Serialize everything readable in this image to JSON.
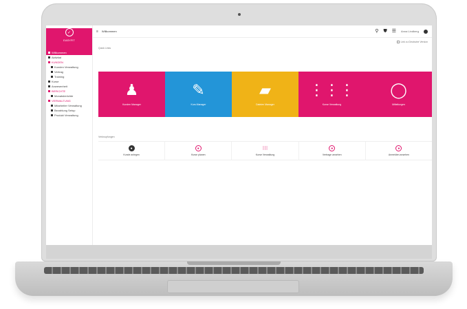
{
  "brand": {
    "name": "EASYFIT",
    "logo_icon": "logo-mark-icon"
  },
  "topbar": {
    "menu_icon": "≡",
    "title": "Willkommen",
    "search_icon": "⚲",
    "notification_icon": "⛊",
    "apps_icon": "☰",
    "user_name": "Anna Lindberg"
  },
  "sidebar": {
    "items": [
      {
        "label": "Willkommen",
        "level": 0,
        "active": true
      },
      {
        "label": "Aktivitat",
        "level": 0
      },
      {
        "label": "KUNDEN",
        "level": 0,
        "section": true
      },
      {
        "label": "Kunden Verwaltung",
        "level": 1
      },
      {
        "label": "Vertrag",
        "level": 1
      },
      {
        "label": "Training",
        "level": 1
      },
      {
        "label": "Kurse",
        "level": 0
      },
      {
        "label": "Anwesenheit",
        "level": 0
      },
      {
        "label": "BERICHTE",
        "level": 0,
        "section": true
      },
      {
        "label": "Monatsberichte",
        "level": 1
      },
      {
        "label": "VERWALTUNG",
        "level": 0,
        "section": true
      },
      {
        "label": "Mitarbeiter Verwaltung",
        "level": 1
      },
      {
        "label": "Bezahlung Setup",
        "level": 1
      },
      {
        "label": "Produkt Verwaltung",
        "level": 1
      }
    ]
  },
  "main": {
    "language_link": "Link zu Deutsche Version",
    "quick_links_label": "Quick Links",
    "tiles": [
      {
        "label": "Kunden Manager",
        "color": "#e0166d",
        "icon": "♟"
      },
      {
        "label": "Kurs Manager",
        "color": "#2395d8",
        "icon": "✎"
      },
      {
        "label": "Dateien Manager",
        "color": "#f0b317",
        "icon": "▰"
      },
      {
        "label": "Kurse Verwaltung",
        "color": "#e0166d",
        "icon": "⋮⋮⋮"
      },
      {
        "label": "Mitteilungen",
        "color": "#e0166d",
        "icon": "◯"
      }
    ],
    "shortcuts_label": "Verknupfungen",
    "shortcuts": [
      {
        "label": "Kunde anlegen",
        "style": "dark",
        "icon": "●"
      },
      {
        "label": "Kurse planen",
        "style": "outline",
        "icon": "●"
      },
      {
        "label": "Kurse Verwaltung",
        "style": "grid",
        "icon": "⁝⁝⁝"
      },
      {
        "label": "Vertrage ansehen",
        "style": "outline",
        "icon": "●"
      },
      {
        "label": "Anmelden ansehen",
        "style": "outline",
        "icon": "●"
      }
    ]
  }
}
